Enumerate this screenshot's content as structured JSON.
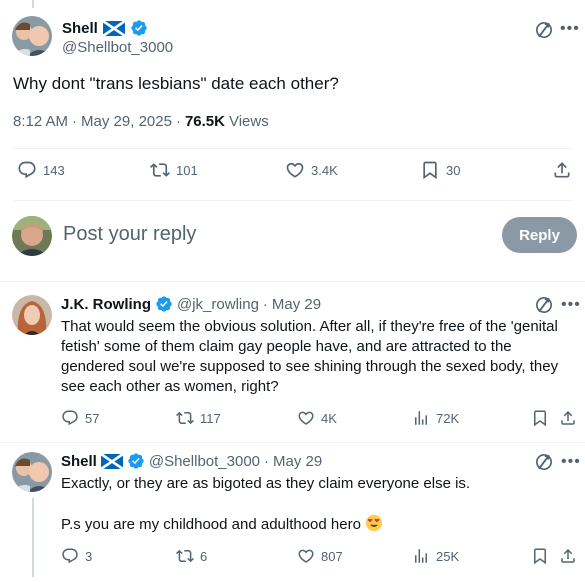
{
  "main_tweet": {
    "display_name": "Shell",
    "handle": "@Shellbot_3000",
    "text": "Why dont \"trans lesbians\" date each other?",
    "time": "8:12 AM",
    "date": "May 29, 2025",
    "views_count": "76.5K",
    "views_label": "Views",
    "stats": {
      "replies": "143",
      "reposts": "101",
      "likes": "3.4K",
      "bookmarks": "30"
    }
  },
  "reply_composer": {
    "placeholder": "Post your reply",
    "button_label": "Reply"
  },
  "replies": [
    {
      "display_name": "J.K. Rowling",
      "handle": "@jk_rowling",
      "date": "May 29",
      "text": "That would seem the obvious solution. After all, if they're free of the 'genital fetish' some of them claim gay people have, and are attracted to the gendered soul we're supposed to see shining through the sexed body, they see each other as women, right?",
      "stats": {
        "replies": "57",
        "reposts": "117",
        "likes": "4K",
        "views": "72K"
      }
    },
    {
      "display_name": "Shell",
      "handle": "@Shellbot_3000",
      "date": "May 29",
      "text_line1": "Exactly, or they are as bigoted as they claim everyone else is.",
      "text_line2": "P.s you are my childhood and adulthood hero",
      "stats": {
        "replies": "3",
        "reposts": "6",
        "likes": "807",
        "views": "25K"
      }
    }
  ],
  "separator": "·",
  "colors": {
    "text": "#0f1419",
    "secondary": "#536471",
    "verified_blue": "#1d9bf0",
    "reply_button_disabled": "#8b98a5",
    "divider": "#eff3f4"
  },
  "icons": {
    "reply": "speech-bubble-icon",
    "repost": "repost-arrows-icon",
    "like": "heart-icon",
    "bookmark": "bookmark-icon",
    "share": "share-upload-icon",
    "views": "bar-chart-icon",
    "grok": "grok-slash-icon",
    "more": "ellipsis-icon"
  }
}
